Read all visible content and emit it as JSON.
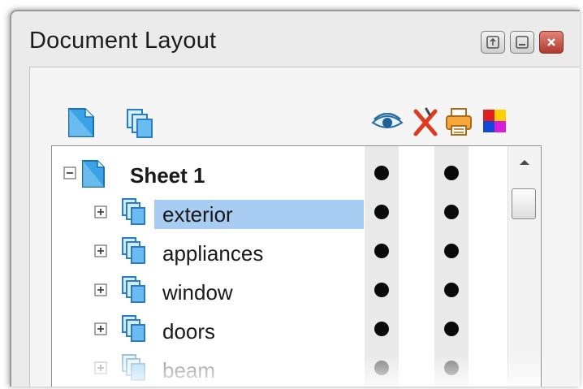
{
  "window": {
    "title": "Document Layout",
    "buttons": [
      "restore-icon",
      "minimize-icon",
      "close-icon"
    ]
  },
  "toolbar": {
    "left_icons": [
      "new-sheet-icon",
      "new-layer-icon"
    ],
    "right_icons": [
      "eye-icon",
      "delete-icon",
      "print-icon",
      "color-icon"
    ]
  },
  "tree": {
    "root": {
      "label": "Sheet 1",
      "expanded": true,
      "visible": true,
      "printable": true
    },
    "layers": [
      {
        "label": "exterior",
        "selected": true,
        "visible": true,
        "printable": true
      },
      {
        "label": "appliances",
        "selected": false,
        "visible": true,
        "printable": true
      },
      {
        "label": "window",
        "selected": false,
        "visible": true,
        "printable": true
      },
      {
        "label": "doors",
        "selected": false,
        "visible": true,
        "printable": true
      },
      {
        "label": "beam",
        "selected": false,
        "visible": true,
        "printable": true
      }
    ]
  },
  "colors": {
    "selection": "#a9cdf2",
    "accent_blue": "#2a8fd8"
  }
}
